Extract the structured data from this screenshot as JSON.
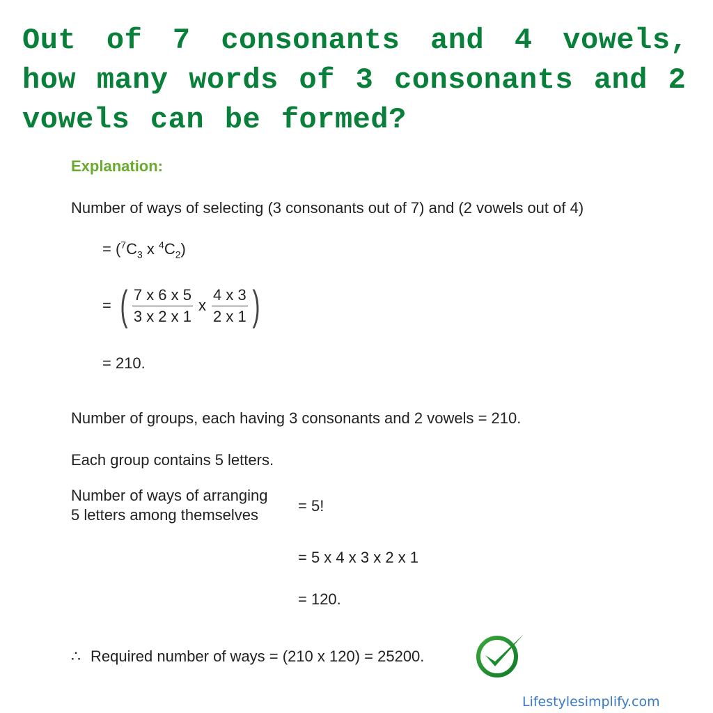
{
  "question": {
    "lines": [
      "Out of 7 consonants and 4 vowels,",
      "how many words of 3 consonants and 2",
      "vowels can be formed?"
    ]
  },
  "explanation": {
    "heading": "Explanation:",
    "step1": "Number of ways of selecting (3 consonants out of 7) and (2 vowels out of 4)",
    "comb": {
      "prefix": "= (",
      "n1": "7",
      "c1": "C",
      "r1": "3",
      "times": " x ",
      "n2": "4",
      "c2": "C",
      "r2": "2",
      "suffix": ")"
    },
    "fraction": {
      "equals": "=",
      "left_paren": "(",
      "num1": "7 x 6 x 5",
      "den1": "3 x 2 x 1",
      "times": "x",
      "num2": "4 x 3",
      "den2": "2 x 1",
      "right_paren": ")"
    },
    "result1": "= 210.",
    "groups": "Number of groups, each having 3 consonants and 2 vowels = 210.",
    "letters": "Each group contains 5 letters.",
    "arrange_label_1": "Number of ways of arranging",
    "arrange_label_2": "5 letters among themselves",
    "arrange_eq1": "= 5!",
    "arrange_eq2": "= 5 x 4 x 3 x 2 x 1",
    "arrange_eq3": "= 120.",
    "therefore_symbol": "∴",
    "final": "Required number of ways = (210 x 120) = 25200."
  },
  "icons": {
    "check": "check-circle-icon"
  },
  "colors": {
    "title": "#08803a",
    "heading": "#6aaa2e",
    "footer": "#3a7bc8"
  },
  "footer": {
    "site": "Lifestylesimplify.com"
  }
}
